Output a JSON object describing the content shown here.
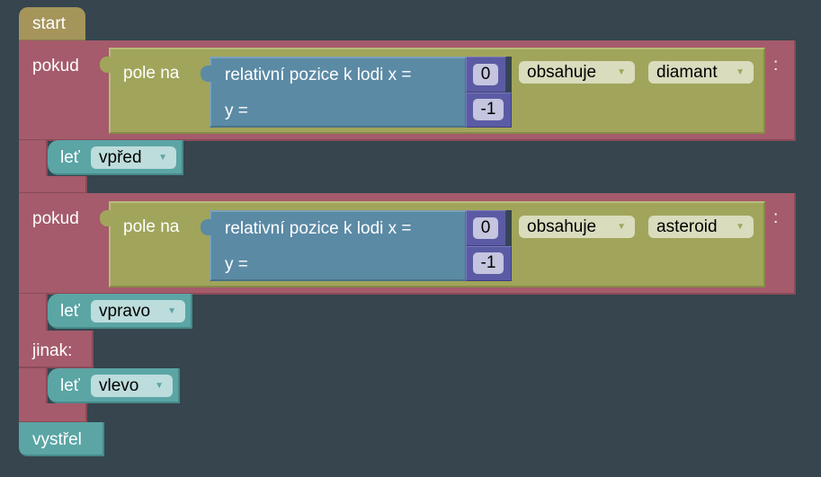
{
  "blocks": {
    "start": "start",
    "if1": {
      "label": "pokud",
      "sensor": "pole na",
      "position": "relativní pozice k lodi x =",
      "y_label": "y =",
      "x": "0",
      "y": "-1",
      "op": "obsahuje",
      "object": "diamant",
      "colon": ":",
      "action_label": "leť",
      "action": "vpřed"
    },
    "if2": {
      "label": "pokud",
      "sensor": "pole na",
      "position": "relativní pozice k lodi x =",
      "y_label": "y =",
      "x": "0",
      "y": "-1",
      "op": "obsahuje",
      "object": "asteroid",
      "colon": ":",
      "action_label": "leť",
      "action": "vpravo"
    },
    "else": {
      "label": "jinak:",
      "action_label": "leť",
      "action": "vlevo"
    },
    "shoot": "vystřel"
  },
  "colors": {
    "background": "#36454e",
    "event": "#a5955b",
    "control": "#a55b6b",
    "sensor": "#a1a55b",
    "position": "#5b8aa5",
    "number": "#5b5ba5",
    "action": "#5ba5a5"
  }
}
